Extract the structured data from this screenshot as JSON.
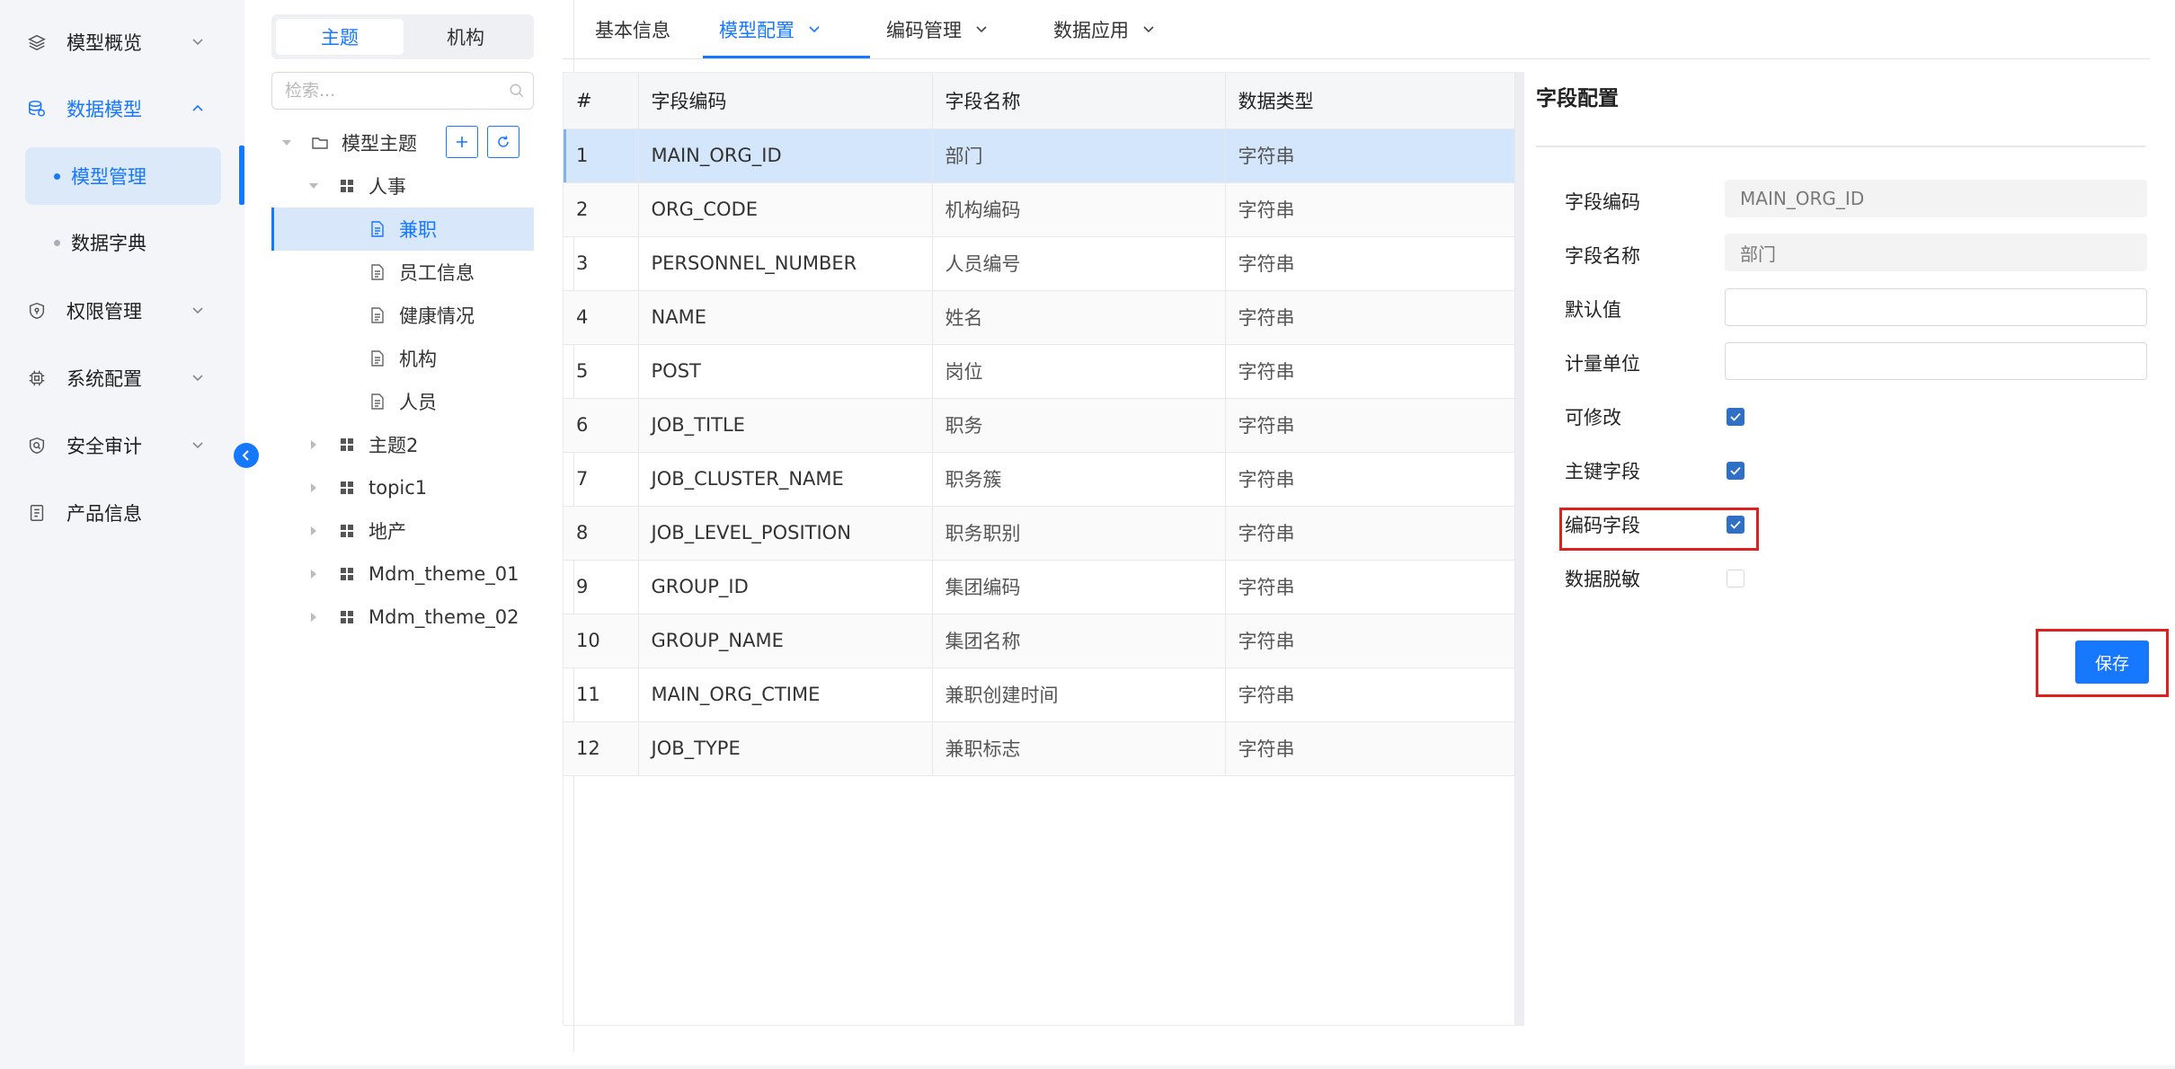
{
  "nav": {
    "items": [
      {
        "label": "模型概览",
        "icon": "layers-icon"
      },
      {
        "label": "数据模型",
        "icon": "database-icon"
      },
      {
        "label": "权限管理",
        "icon": "shield-icon"
      },
      {
        "label": "系统配置",
        "icon": "chip-icon"
      },
      {
        "label": "安全审计",
        "icon": "audit-shield-icon"
      },
      {
        "label": "产品信息",
        "icon": "document-list-icon"
      }
    ],
    "subitems": [
      {
        "label": "模型管理"
      },
      {
        "label": "数据字典"
      }
    ]
  },
  "tree": {
    "segments": [
      "主题",
      "机构"
    ],
    "search_placeholder": "检索...",
    "root": "模型主题",
    "nodes": [
      "人事",
      "兼职",
      "员工信息",
      "健康情况",
      "机构",
      "人员",
      "主题2",
      "topic1",
      "地产",
      "Mdm_theme_01",
      "Mdm_theme_02"
    ]
  },
  "tabs": [
    "基本信息",
    "模型配置",
    "编码管理",
    "数据应用"
  ],
  "table": {
    "headers": [
      "#",
      "字段编码",
      "字段名称",
      "数据类型"
    ],
    "rows": [
      [
        "1",
        "MAIN_ORG_ID",
        "部门",
        "字符串"
      ],
      [
        "2",
        "ORG_CODE",
        "机构编码",
        "字符串"
      ],
      [
        "3",
        "PERSONNEL_NUMBER",
        "人员编号",
        "字符串"
      ],
      [
        "4",
        "NAME",
        "姓名",
        "字符串"
      ],
      [
        "5",
        "POST",
        "岗位",
        "字符串"
      ],
      [
        "6",
        "JOB_TITLE",
        "职务",
        "字符串"
      ],
      [
        "7",
        "JOB_CLUSTER_NAME",
        "职务簇",
        "字符串"
      ],
      [
        "8",
        "JOB_LEVEL_POSITION",
        "职务职别",
        "字符串"
      ],
      [
        "9",
        "GROUP_ID",
        "集团编码",
        "字符串"
      ],
      [
        "10",
        "GROUP_NAME",
        "集团名称",
        "字符串"
      ],
      [
        "11",
        "MAIN_ORG_CTIME",
        "兼职创建时间",
        "字符串"
      ],
      [
        "12",
        "JOB_TYPE",
        "兼职标志",
        "字符串"
      ]
    ]
  },
  "config": {
    "title": "字段配置",
    "labels": [
      "字段编码",
      "字段名称",
      "默认值",
      "计量单位",
      "可修改",
      "主键字段",
      "编码字段",
      "数据脱敏"
    ],
    "field_code_value": "MAIN_ORG_ID",
    "field_name_value": "部门",
    "default_value": "",
    "unit_value": "",
    "checkboxes": {
      "modifiable": true,
      "primary_key": true,
      "code_field": true,
      "desensitize": false
    },
    "save_label": "保存"
  },
  "colors": {
    "accent": "#1677ff",
    "highlight_box": "#e02020",
    "selected_row": "#d4e6fb"
  }
}
